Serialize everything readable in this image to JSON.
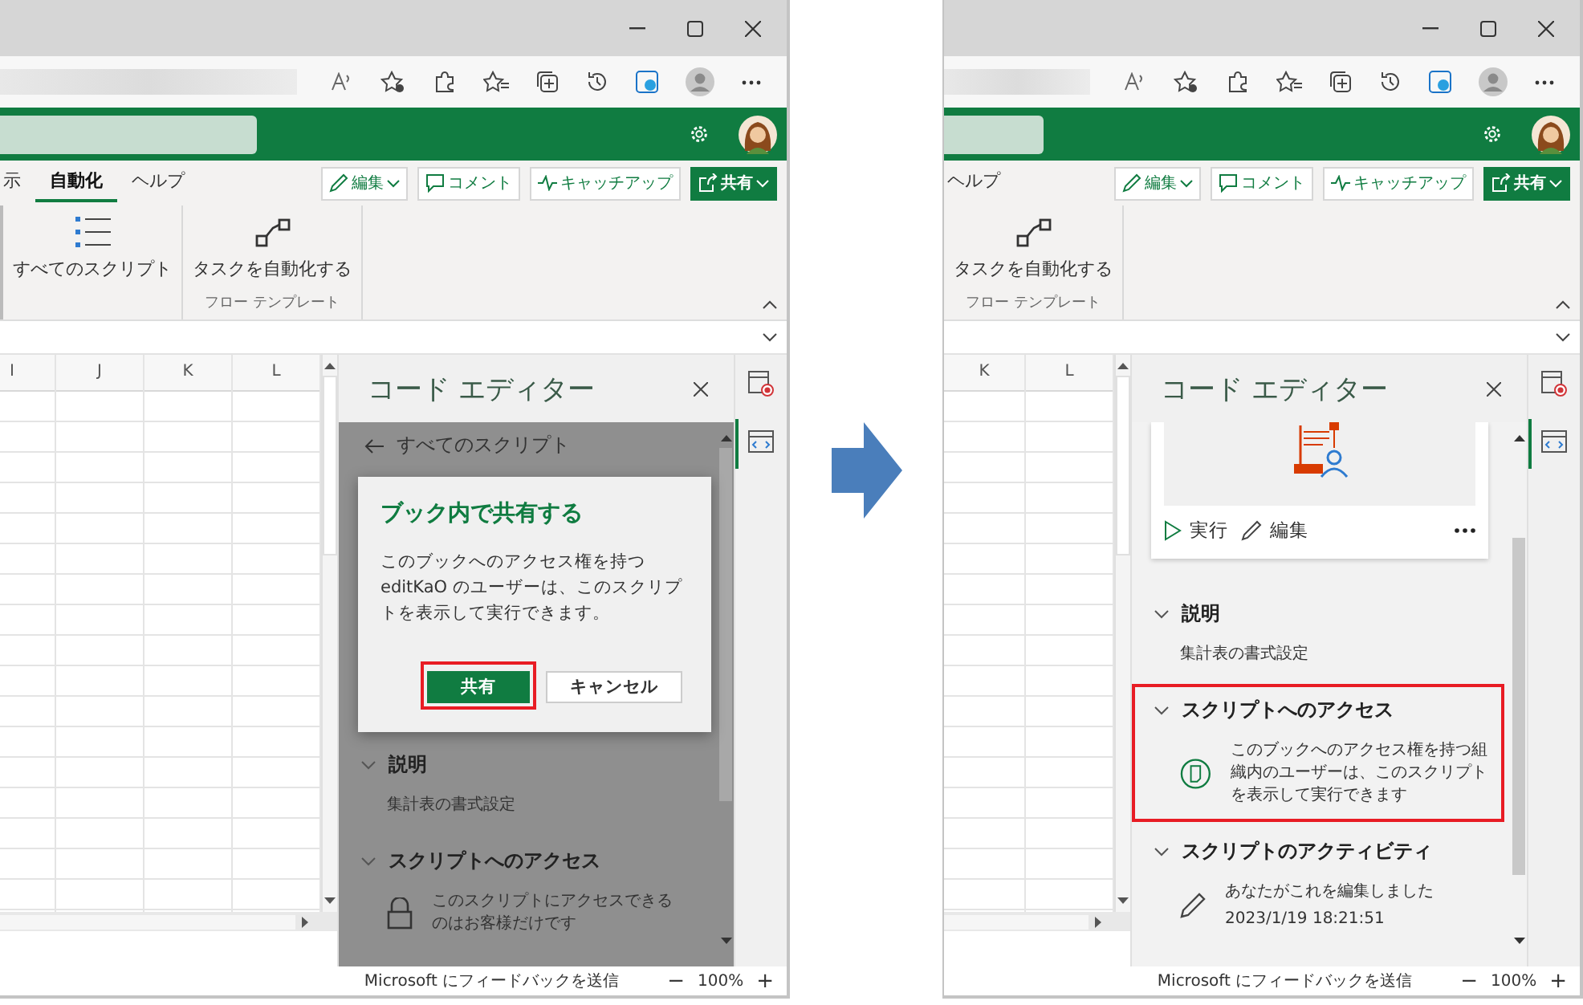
{
  "screens": [
    {
      "tabs": [
        {
          "label": "示",
          "selected": false
        },
        {
          "label": "自動化",
          "selected": true
        },
        {
          "label": "ヘルプ",
          "selected": false
        }
      ],
      "toolbar_buttons": [
        {
          "kind": "edit",
          "label": "編集",
          "dropdown": true
        },
        {
          "kind": "comment",
          "label": "コメント",
          "dropdown": false
        },
        {
          "kind": "catchup",
          "label": "キャッチアップ",
          "dropdown": false
        },
        {
          "kind": "share",
          "label": "共有",
          "dropdown": true
        }
      ],
      "ribbon_groups": [
        {
          "commands": [
            {
              "kind": "scripts",
              "label": "すべてのスクリプト"
            }
          ]
        },
        {
          "label": "フロー テンプレート",
          "commands": [
            {
              "kind": "flow",
              "label": "タスクを自動化する"
            }
          ]
        }
      ],
      "columns": [
        "I",
        "J",
        "K",
        "L"
      ],
      "code_editor": {
        "title": "コード エディター",
        "dimmed": true,
        "back_link": "すべてのスクリプト",
        "dialog": {
          "title": "ブック内で共有する",
          "body": "このブックへのアクセス権を持つ editKaO のユーザーは、このスクリプトを表示して実行できます。",
          "buttons": [
            {
              "label": "共有",
              "primary": true,
              "highlighted": true
            },
            {
              "label": "キャンセル",
              "primary": false,
              "highlighted": false
            }
          ]
        },
        "sections": [
          {
            "title": "説明",
            "expanded": true,
            "highlighted": false,
            "items": [
              {
                "kind": "text",
                "text": "集計表の書式設定"
              }
            ]
          },
          {
            "title": "スクリプトへのアクセス",
            "expanded": true,
            "highlighted": false,
            "items": [
              {
                "kind": "lock",
                "text": "このスクリプトにアクセスできるのはお客様だけです"
              }
            ]
          }
        ]
      },
      "status_bar": {
        "feedback": "Microsoft にフィードバックを送信",
        "zoom_out": "−",
        "zoom": "100%",
        "zoom_in": "+"
      }
    },
    {
      "tabs": [
        {
          "label": "ヘルプ",
          "selected": false
        }
      ],
      "toolbar_buttons": [
        {
          "kind": "edit",
          "label": "編集",
          "dropdown": true
        },
        {
          "kind": "comment",
          "label": "コメント",
          "dropdown": false
        },
        {
          "kind": "catchup",
          "label": "キャッチアップ",
          "dropdown": false
        },
        {
          "kind": "share",
          "label": "共有",
          "dropdown": true
        }
      ],
      "ribbon_groups": [
        {
          "label": "フロー テンプレート",
          "commands": [
            {
              "kind": "flow",
              "label": "タスクを自動化する"
            }
          ]
        }
      ],
      "columns": [
        "K",
        "L"
      ],
      "code_editor": {
        "title": "コード エディター",
        "dimmed": false,
        "script_card": {
          "actions": [
            {
              "kind": "run",
              "label": "実行"
            },
            {
              "kind": "edit",
              "label": "編集"
            }
          ]
        },
        "sections": [
          {
            "title": "説明",
            "expanded": true,
            "highlighted": false,
            "items": [
              {
                "kind": "text",
                "text": "集計表の書式設定"
              }
            ]
          },
          {
            "title": "スクリプトへのアクセス",
            "expanded": true,
            "highlighted": true,
            "items": [
              {
                "kind": "shared",
                "text": "このブックへのアクセス権を持つ組織内のユーザーは、このスクリプトを表示して実行できます"
              }
            ]
          },
          {
            "title": "スクリプトのアクティビティ",
            "expanded": true,
            "highlighted": false,
            "items": [
              {
                "kind": "pencil",
                "text": "あなたがこれを編集しました",
                "detail": "2023/1/19 18:21:51"
              }
            ]
          }
        ]
      },
      "status_bar": {
        "feedback": "Microsoft にフィードバックを送信",
        "zoom_out": "−",
        "zoom": "100%",
        "zoom_in": "+"
      }
    }
  ]
}
